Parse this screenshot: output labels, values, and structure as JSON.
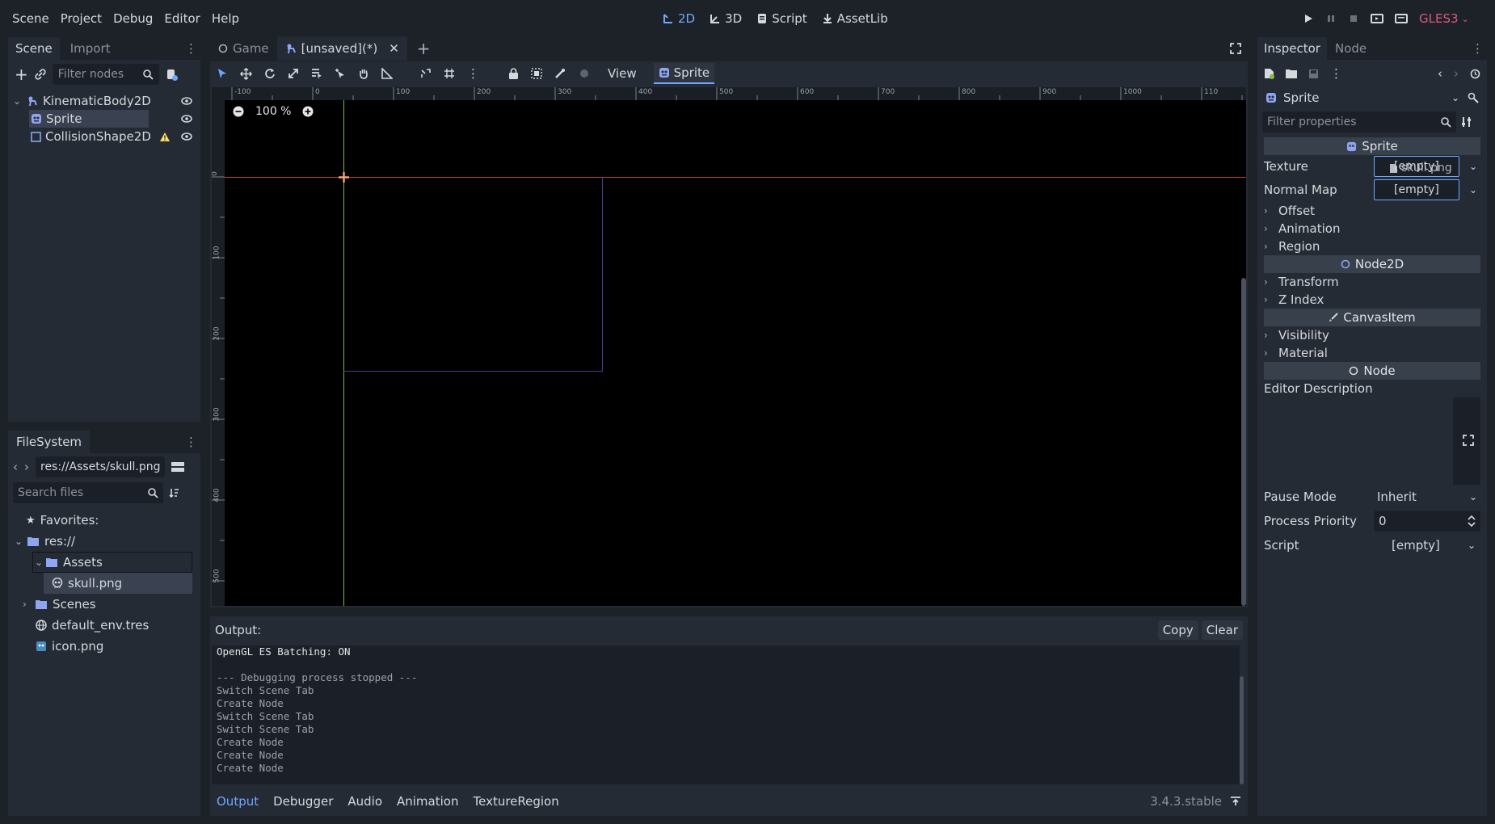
{
  "menu": {
    "items": [
      "Scene",
      "Project",
      "Debug",
      "Editor",
      "Help"
    ],
    "workspaces": [
      {
        "label": "2D",
        "icon": "2d-icon",
        "active": true
      },
      {
        "label": "3D",
        "icon": "3d-icon",
        "active": false
      },
      {
        "label": "Script",
        "icon": "script-icon",
        "active": false
      },
      {
        "label": "AssetLib",
        "icon": "assetlib-icon",
        "active": false
      }
    ],
    "renderer": "GLES3"
  },
  "scene_dock": {
    "tabs": [
      "Scene",
      "Import"
    ],
    "filter_placeholder": "Filter nodes",
    "nodes": [
      {
        "label": "KinematicBody2D",
        "icon": "kinematicbody2d-icon",
        "selected": false,
        "warning": false
      },
      {
        "label": "Sprite",
        "icon": "sprite-icon",
        "selected": true,
        "warning": false
      },
      {
        "label": "CollisionShape2D",
        "icon": "collisionshape2d-icon",
        "selected": false,
        "warning": true
      }
    ]
  },
  "filesystem": {
    "title": "FileSystem",
    "path": "res://Assets/skull.png",
    "search_placeholder": "Search files",
    "items": [
      {
        "label": "Favorites:",
        "icon": "star-icon"
      },
      {
        "label": "res://",
        "icon": "folder-icon"
      },
      {
        "label": "Assets",
        "icon": "folder-icon"
      },
      {
        "label": "skull.png",
        "icon": "skull-icon"
      },
      {
        "label": "Scenes",
        "icon": "folder-icon"
      },
      {
        "label": "default_env.tres",
        "icon": "environment-icon"
      },
      {
        "label": "icon.png",
        "icon": "image-icon"
      }
    ]
  },
  "editor_tabs": [
    {
      "label": "Game",
      "active": false
    },
    {
      "label": "[unsaved](*)",
      "active": true
    }
  ],
  "toolbar": {
    "view_label": "View",
    "sprite_label": "Sprite"
  },
  "viewport": {
    "zoom": "100 %",
    "ruler_x": [
      "-100",
      "0",
      "100",
      "200",
      "300",
      "400",
      "500",
      "600",
      "700",
      "800",
      "900",
      "1000",
      "110"
    ],
    "ruler_y": [
      "0",
      "100",
      "200",
      "300",
      "400",
      "500"
    ]
  },
  "output": {
    "title": "Output:",
    "copy_label": "Copy",
    "clear_label": "Clear",
    "lines": [
      "OpenGL ES Batching: ON",
      "",
      "--- Debugging process stopped ---",
      "Switch Scene Tab",
      "Create Node",
      "Switch Scene Tab",
      "Switch Scene Tab",
      "Create Node",
      "Create Node",
      "Create Node"
    ],
    "bottom_tabs": [
      "Output",
      "Debugger",
      "Audio",
      "Animation",
      "TextureRegion"
    ],
    "version": "3.4.3.stable"
  },
  "inspector": {
    "tabs": [
      "Inspector",
      "Node"
    ],
    "object": "Sprite",
    "filter_placeholder": "Filter properties",
    "sprite_section": "Sprite",
    "texture_label": "Texture",
    "texture_value": "[empty]",
    "drag_preview": "skull.png",
    "normal_map_label": "Normal Map",
    "normal_map_value": "[empty]",
    "sprite_groups": [
      "Offset",
      "Animation",
      "Region"
    ],
    "node2d_section": "Node2D",
    "node2d_groups": [
      "Transform",
      "Z Index"
    ],
    "canvasitem_section": "CanvasItem",
    "canvasitem_groups": [
      "Visibility",
      "Material"
    ],
    "node_section": "Node",
    "editor_description_label": "Editor Description",
    "pause_mode_label": "Pause Mode",
    "pause_mode_value": "Inherit",
    "process_priority_label": "Process Priority",
    "process_priority_value": "0",
    "script_label": "Script",
    "script_value": "[empty]"
  },
  "colors": {
    "accent": "#6ea8fe",
    "warning": "#ffdd65",
    "x_axis": "#c8334a",
    "y_axis": "#7bbf3a",
    "renderer": "#e0587a"
  }
}
